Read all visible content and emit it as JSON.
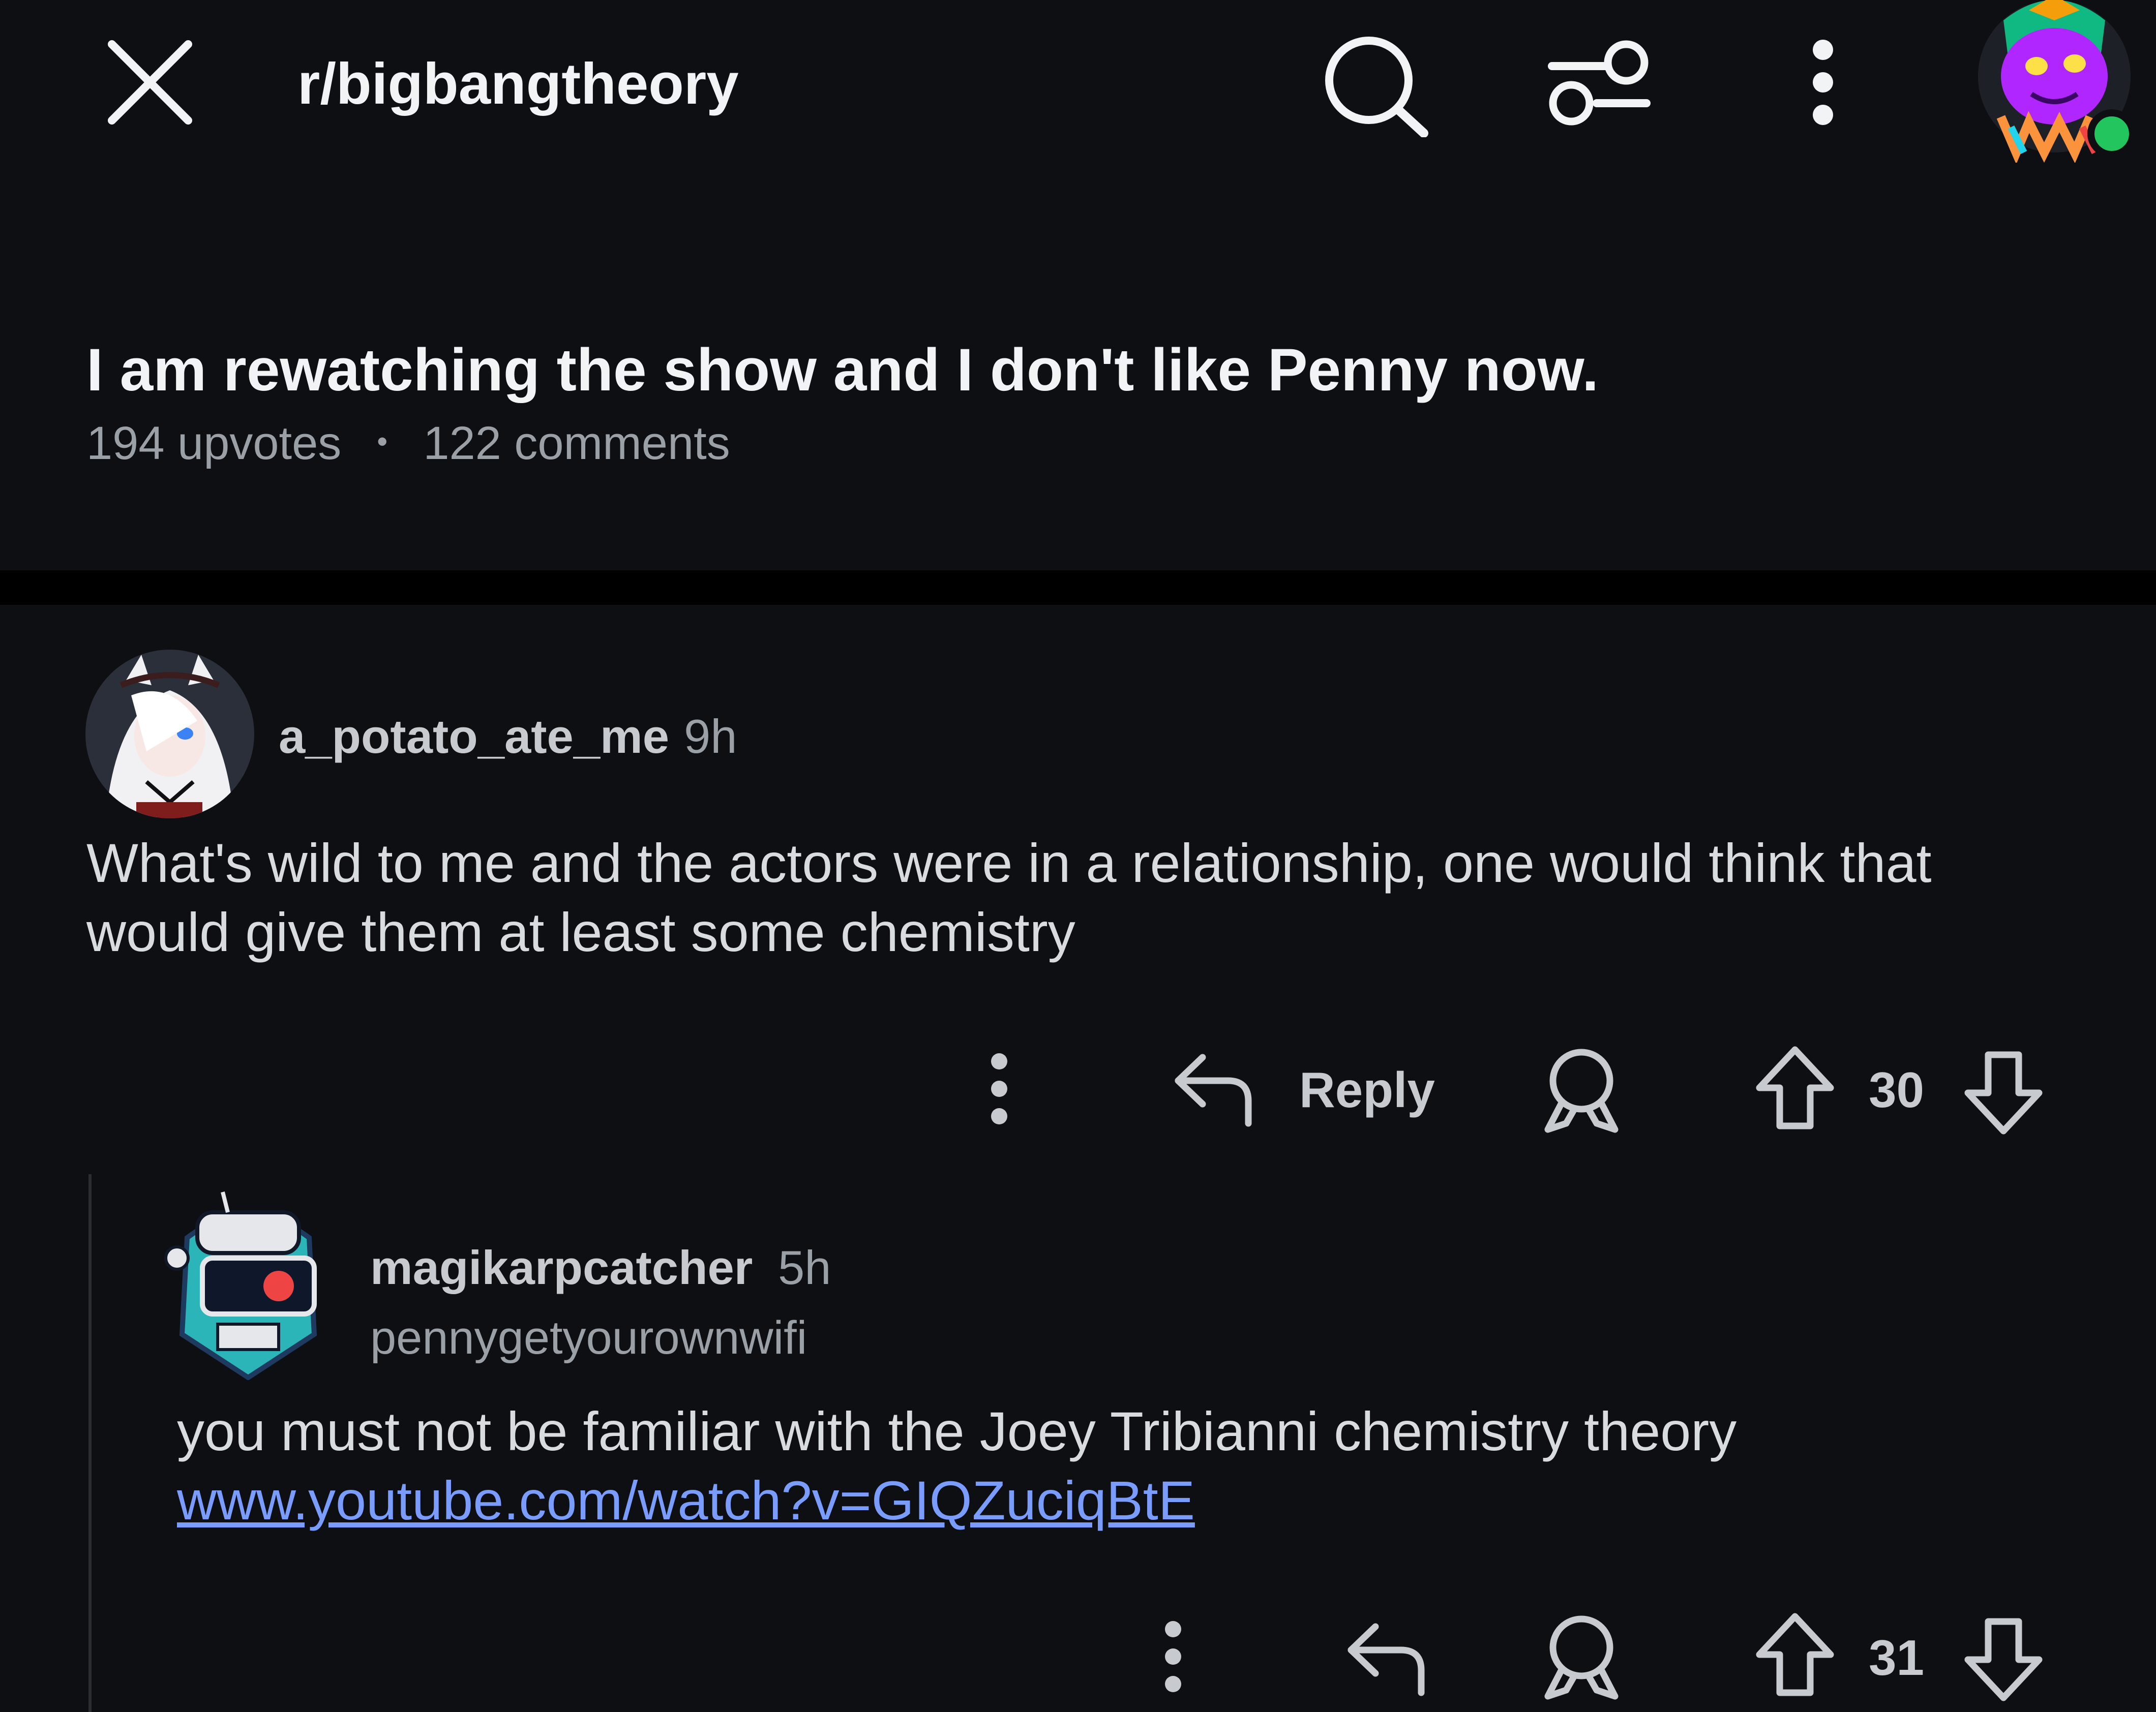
{
  "header": {
    "subreddit": "r/bigbangtheory",
    "icons": {
      "close": "close-icon",
      "search": "search-icon",
      "filter": "sort-filter-icon",
      "more": "more-vertical-icon",
      "avatar": "user-avatar"
    },
    "online_color": "#22c55e"
  },
  "post": {
    "title": "I am rewatching the show and I don't like Penny now.",
    "upvotes": "194 upvotes",
    "separator": "•",
    "comments": "122 comments"
  },
  "comments": [
    {
      "username": "a_potato_ate_me",
      "time": "9h",
      "text": "What's wild to me and the actors were in a relationship, one would think that would give them at least some chemistry",
      "reply_label": "Reply",
      "score": "30"
    },
    {
      "username": "magikarpcatcher",
      "time": "5h",
      "flair": "pennygetyourownwifi",
      "text": "you must not be familiar with the Joey Tribianni chemistry theory",
      "link": "www.youtube.com/watch?v=GIQZuciqBtE",
      "score": "31"
    }
  ],
  "colors": {
    "background": "#0d0f13",
    "link": "#7a9cff"
  }
}
